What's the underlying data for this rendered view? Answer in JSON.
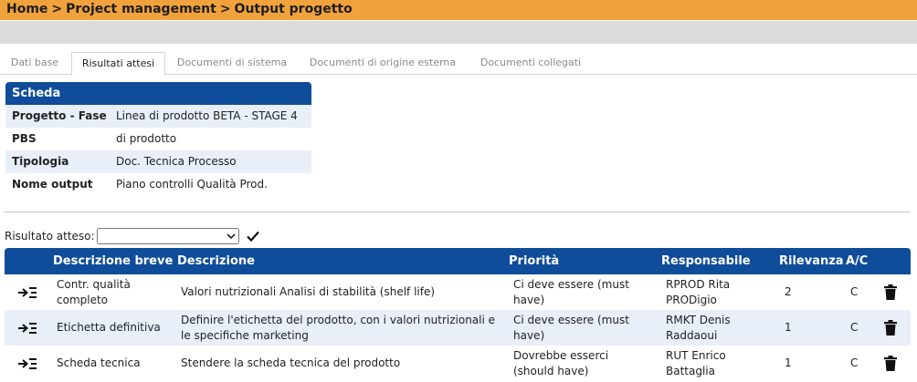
{
  "breadcrumb": {
    "home": "Home",
    "section": "Project management",
    "page": "Output progetto",
    "separator": ">"
  },
  "tabs": [
    {
      "label": "Dati base",
      "active": false
    },
    {
      "label": "Risultati attesi",
      "active": true
    },
    {
      "label": "Documenti di sistema",
      "active": false
    },
    {
      "label": "Documenti di origine esterna",
      "active": false
    },
    {
      "label": "Documenti collegati",
      "active": false
    }
  ],
  "scheda": {
    "title": "Scheda",
    "rows": [
      {
        "label": "Progetto - Fase",
        "value": "Linea di prodotto BETA - STAGE 4"
      },
      {
        "label": "PBS",
        "value": "di prodotto"
      },
      {
        "label": "Tipologia",
        "value": "Doc. Tecnica Processo"
      },
      {
        "label": "Nome output",
        "value": "Piano controlli Qualità Prod."
      }
    ]
  },
  "risultato_atteso": {
    "label": "Risultato atteso:",
    "selected_value": ""
  },
  "table": {
    "headers": {
      "breve": "Descrizione breve",
      "descrizione": "Descrizione",
      "priorita": "Priorità",
      "responsabile": "Responsabile",
      "rilevanza": "Rilevanza",
      "ac": "A/C"
    },
    "rows": [
      {
        "breve": "Contr. qualità completo",
        "descrizione": "Valori nutrizionali Analisi di stabilità (shelf life)",
        "priorita": "Ci deve essere (must have)",
        "responsabile": "RPROD Rita PRODigio",
        "rilevanza": "2",
        "ac": "C"
      },
      {
        "breve": "Etichetta definitiva",
        "descrizione": "Definire l'etichetta del prodotto, con i valori nutrizionali e le specifiche marketing",
        "priorita": "Ci deve essere (must have)",
        "responsabile": "RMKT Denis Raddaoui",
        "rilevanza": "1",
        "ac": "C"
      },
      {
        "breve": "Scheda tecnica",
        "descrizione": "Stendere la scheda tecnica del prodotto",
        "priorita": "Dovrebbe esserci (should have)",
        "responsabile": "RUT Enrico Battaglia",
        "rilevanza": "1",
        "ac": "C"
      }
    ]
  },
  "icons": {
    "move": "move-to-icon",
    "trash": "trash-icon",
    "check": "checkmark-icon",
    "dropdown": "chevron-down-icon"
  },
  "colors": {
    "topbar": "#f2a23c",
    "header_blue": "#0f4c9a",
    "row_alt": "#e8eff8",
    "graybar": "#dcdcdc"
  }
}
